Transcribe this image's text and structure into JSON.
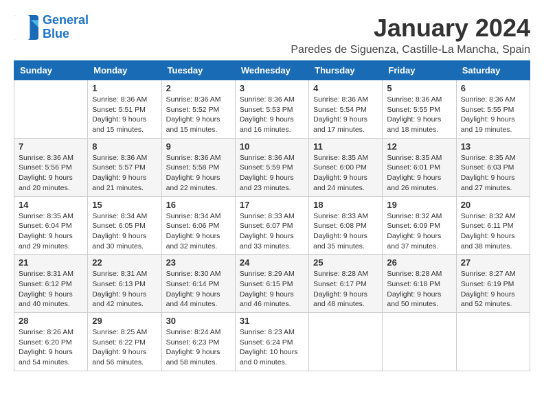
{
  "logo": {
    "text_general": "General",
    "text_blue": "Blue"
  },
  "title": "January 2024",
  "location": "Paredes de Siguenza, Castille-La Mancha, Spain",
  "weekdays": [
    "Sunday",
    "Monday",
    "Tuesday",
    "Wednesday",
    "Thursday",
    "Friday",
    "Saturday"
  ],
  "weeks": [
    [
      {
        "day": "",
        "sunrise": "",
        "sunset": "",
        "daylight": ""
      },
      {
        "day": "1",
        "sunrise": "Sunrise: 8:36 AM",
        "sunset": "Sunset: 5:51 PM",
        "daylight": "Daylight: 9 hours and 15 minutes."
      },
      {
        "day": "2",
        "sunrise": "Sunrise: 8:36 AM",
        "sunset": "Sunset: 5:52 PM",
        "daylight": "Daylight: 9 hours and 15 minutes."
      },
      {
        "day": "3",
        "sunrise": "Sunrise: 8:36 AM",
        "sunset": "Sunset: 5:53 PM",
        "daylight": "Daylight: 9 hours and 16 minutes."
      },
      {
        "day": "4",
        "sunrise": "Sunrise: 8:36 AM",
        "sunset": "Sunset: 5:54 PM",
        "daylight": "Daylight: 9 hours and 17 minutes."
      },
      {
        "day": "5",
        "sunrise": "Sunrise: 8:36 AM",
        "sunset": "Sunset: 5:55 PM",
        "daylight": "Daylight: 9 hours and 18 minutes."
      },
      {
        "day": "6",
        "sunrise": "Sunrise: 8:36 AM",
        "sunset": "Sunset: 5:55 PM",
        "daylight": "Daylight: 9 hours and 19 minutes."
      }
    ],
    [
      {
        "day": "7",
        "sunrise": "Sunrise: 8:36 AM",
        "sunset": "Sunset: 5:56 PM",
        "daylight": "Daylight: 9 hours and 20 minutes."
      },
      {
        "day": "8",
        "sunrise": "Sunrise: 8:36 AM",
        "sunset": "Sunset: 5:57 PM",
        "daylight": "Daylight: 9 hours and 21 minutes."
      },
      {
        "day": "9",
        "sunrise": "Sunrise: 8:36 AM",
        "sunset": "Sunset: 5:58 PM",
        "daylight": "Daylight: 9 hours and 22 minutes."
      },
      {
        "day": "10",
        "sunrise": "Sunrise: 8:36 AM",
        "sunset": "Sunset: 5:59 PM",
        "daylight": "Daylight: 9 hours and 23 minutes."
      },
      {
        "day": "11",
        "sunrise": "Sunrise: 8:35 AM",
        "sunset": "Sunset: 6:00 PM",
        "daylight": "Daylight: 9 hours and 24 minutes."
      },
      {
        "day": "12",
        "sunrise": "Sunrise: 8:35 AM",
        "sunset": "Sunset: 6:01 PM",
        "daylight": "Daylight: 9 hours and 26 minutes."
      },
      {
        "day": "13",
        "sunrise": "Sunrise: 8:35 AM",
        "sunset": "Sunset: 6:03 PM",
        "daylight": "Daylight: 9 hours and 27 minutes."
      }
    ],
    [
      {
        "day": "14",
        "sunrise": "Sunrise: 8:35 AM",
        "sunset": "Sunset: 6:04 PM",
        "daylight": "Daylight: 9 hours and 29 minutes."
      },
      {
        "day": "15",
        "sunrise": "Sunrise: 8:34 AM",
        "sunset": "Sunset: 6:05 PM",
        "daylight": "Daylight: 9 hours and 30 minutes."
      },
      {
        "day": "16",
        "sunrise": "Sunrise: 8:34 AM",
        "sunset": "Sunset: 6:06 PM",
        "daylight": "Daylight: 9 hours and 32 minutes."
      },
      {
        "day": "17",
        "sunrise": "Sunrise: 8:33 AM",
        "sunset": "Sunset: 6:07 PM",
        "daylight": "Daylight: 9 hours and 33 minutes."
      },
      {
        "day": "18",
        "sunrise": "Sunrise: 8:33 AM",
        "sunset": "Sunset: 6:08 PM",
        "daylight": "Daylight: 9 hours and 35 minutes."
      },
      {
        "day": "19",
        "sunrise": "Sunrise: 8:32 AM",
        "sunset": "Sunset: 6:09 PM",
        "daylight": "Daylight: 9 hours and 37 minutes."
      },
      {
        "day": "20",
        "sunrise": "Sunrise: 8:32 AM",
        "sunset": "Sunset: 6:11 PM",
        "daylight": "Daylight: 9 hours and 38 minutes."
      }
    ],
    [
      {
        "day": "21",
        "sunrise": "Sunrise: 8:31 AM",
        "sunset": "Sunset: 6:12 PM",
        "daylight": "Daylight: 9 hours and 40 minutes."
      },
      {
        "day": "22",
        "sunrise": "Sunrise: 8:31 AM",
        "sunset": "Sunset: 6:13 PM",
        "daylight": "Daylight: 9 hours and 42 minutes."
      },
      {
        "day": "23",
        "sunrise": "Sunrise: 8:30 AM",
        "sunset": "Sunset: 6:14 PM",
        "daylight": "Daylight: 9 hours and 44 minutes."
      },
      {
        "day": "24",
        "sunrise": "Sunrise: 8:29 AM",
        "sunset": "Sunset: 6:15 PM",
        "daylight": "Daylight: 9 hours and 46 minutes."
      },
      {
        "day": "25",
        "sunrise": "Sunrise: 8:28 AM",
        "sunset": "Sunset: 6:17 PM",
        "daylight": "Daylight: 9 hours and 48 minutes."
      },
      {
        "day": "26",
        "sunrise": "Sunrise: 8:28 AM",
        "sunset": "Sunset: 6:18 PM",
        "daylight": "Daylight: 9 hours and 50 minutes."
      },
      {
        "day": "27",
        "sunrise": "Sunrise: 8:27 AM",
        "sunset": "Sunset: 6:19 PM",
        "daylight": "Daylight: 9 hours and 52 minutes."
      }
    ],
    [
      {
        "day": "28",
        "sunrise": "Sunrise: 8:26 AM",
        "sunset": "Sunset: 6:20 PM",
        "daylight": "Daylight: 9 hours and 54 minutes."
      },
      {
        "day": "29",
        "sunrise": "Sunrise: 8:25 AM",
        "sunset": "Sunset: 6:22 PM",
        "daylight": "Daylight: 9 hours and 56 minutes."
      },
      {
        "day": "30",
        "sunrise": "Sunrise: 8:24 AM",
        "sunset": "Sunset: 6:23 PM",
        "daylight": "Daylight: 9 hours and 58 minutes."
      },
      {
        "day": "31",
        "sunrise": "Sunrise: 8:23 AM",
        "sunset": "Sunset: 6:24 PM",
        "daylight": "Daylight: 10 hours and 0 minutes."
      },
      {
        "day": "",
        "sunrise": "",
        "sunset": "",
        "daylight": ""
      },
      {
        "day": "",
        "sunrise": "",
        "sunset": "",
        "daylight": ""
      },
      {
        "day": "",
        "sunrise": "",
        "sunset": "",
        "daylight": ""
      }
    ]
  ]
}
